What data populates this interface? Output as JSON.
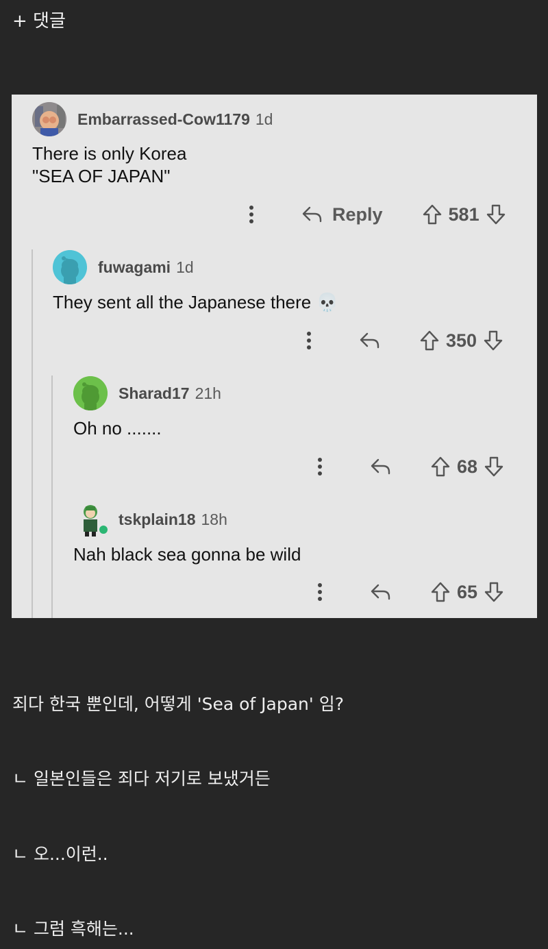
{
  "header": {
    "add_comment_label": "+ 댓글"
  },
  "thread": {
    "reply_label": "Reply",
    "comments": [
      {
        "username": "Embarrassed-Cow1179",
        "age": "1d",
        "lines": [
          "There is only Korea",
          "\"SEA OF JAPAN\""
        ],
        "score": "581"
      },
      {
        "username": "fuwagami",
        "age": "1d",
        "lines": [
          "They sent all the Japanese there 💀"
        ],
        "score": "350"
      },
      {
        "username": "Sharad17",
        "age": "21h",
        "lines": [
          "Oh no ......."
        ],
        "score": "68"
      },
      {
        "username": "tskplain18",
        "age": "18h",
        "lines": [
          "Nah black sea gonna be wild"
        ],
        "score": "65"
      }
    ]
  },
  "translations": [
    "죄다 한국 뿐인데, 어떻게 'Sea of Japan' 임?",
    "ㄴ 일본인들은 죄다 저기로 보냈거든",
    "ㄴ 오...이런..",
    "ㄴ 그럼 흑해는..."
  ],
  "colors": {
    "page_bg": "#262626",
    "card_bg": "#e6e6e6",
    "snoo_blue": "#4fc3d6",
    "snoo_green": "#6cc04a",
    "online": "#2bb673"
  }
}
